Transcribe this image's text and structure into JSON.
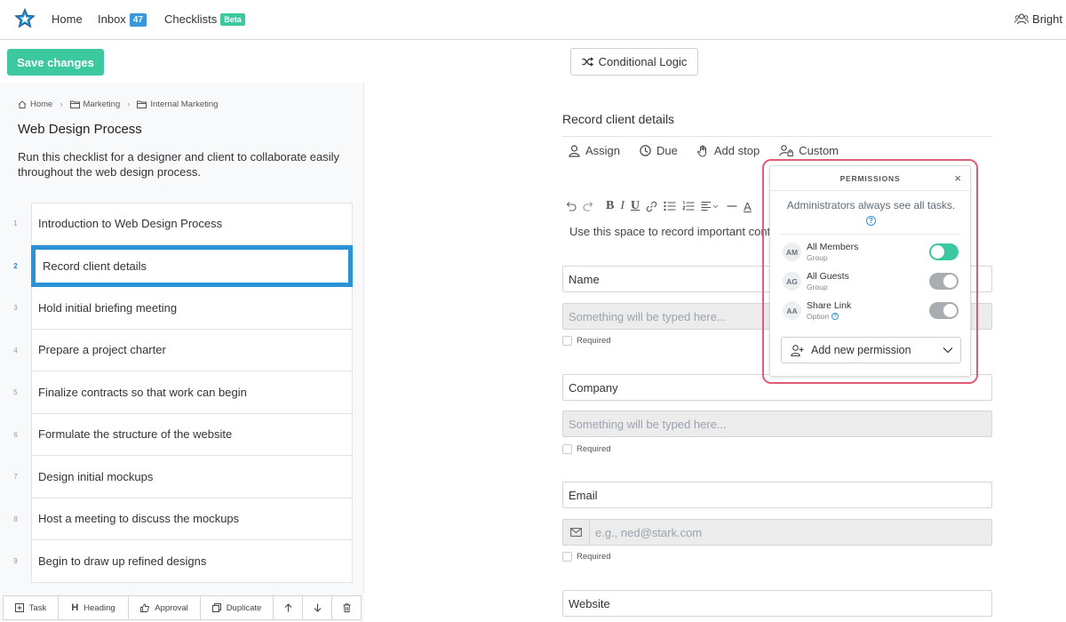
{
  "nav": {
    "home": "Home",
    "inbox": "Inbox",
    "inbox_count": "47",
    "checklists": "Checklists",
    "checklists_badge": "Beta",
    "user": "Bright"
  },
  "toolbar": {
    "save_label": "Save changes",
    "conditional_logic": "Conditional Logic"
  },
  "breadcrumb": [
    "Home",
    "Marketing",
    "Internal Marketing"
  ],
  "checklist": {
    "title": "Web Design Process",
    "description": "Run this checklist for a designer and client to collaborate easily throughout the web design process."
  },
  "tasks": [
    {
      "num": "1",
      "label": "Introduction to Web Design Process"
    },
    {
      "num": "2",
      "label": "Record client details"
    },
    {
      "num": "3",
      "label": "Hold initial briefing meeting"
    },
    {
      "num": "4",
      "label": "Prepare a project charter"
    },
    {
      "num": "5",
      "label": "Finalize contracts so that work can begin"
    },
    {
      "num": "6",
      "label": "Formulate the structure of the website"
    },
    {
      "num": "7",
      "label": "Design initial mockups"
    },
    {
      "num": "8",
      "label": "Host a meeting to discuss the mockups"
    },
    {
      "num": "9",
      "label": "Begin to draw up refined designs"
    }
  ],
  "active_task_index": 1,
  "bottom_toolbar": {
    "task": "Task",
    "heading": "Heading",
    "approval": "Approval",
    "duplicate": "Duplicate"
  },
  "task_detail": {
    "title": "Record client details",
    "actions": {
      "assign": "Assign",
      "due": "Due",
      "add_stop": "Add stop",
      "custom": "Custom"
    },
    "editor_text": "Use this space to record important cont",
    "fields": [
      {
        "label": "Name",
        "placeholder": "Something will be typed here...",
        "required": "Required"
      },
      {
        "label": "Company",
        "placeholder": "Something will be typed here...",
        "required": "Required"
      },
      {
        "label": "Email",
        "placeholder": "e.g., ned@stark.com",
        "required": "Required"
      },
      {
        "label": "Website"
      }
    ]
  },
  "permissions": {
    "header": "PERMISSIONS",
    "close": "×",
    "note": "Administrators always see all tasks.",
    "rows": [
      {
        "initials": "AM",
        "name": "All Members",
        "type": "Group",
        "enabled": true
      },
      {
        "initials": "AG",
        "name": "All Guests",
        "type": "Group",
        "enabled": false
      },
      {
        "initials": "AA",
        "name": "Share Link",
        "type": "Option",
        "enabled": false
      }
    ],
    "add_label": "Add new permission"
  },
  "colors": {
    "accent_green": "#3cc9a0",
    "accent_blue": "#2a93d8",
    "highlight_pink": "#e05d78",
    "inbox_badge": "#3897dd"
  }
}
